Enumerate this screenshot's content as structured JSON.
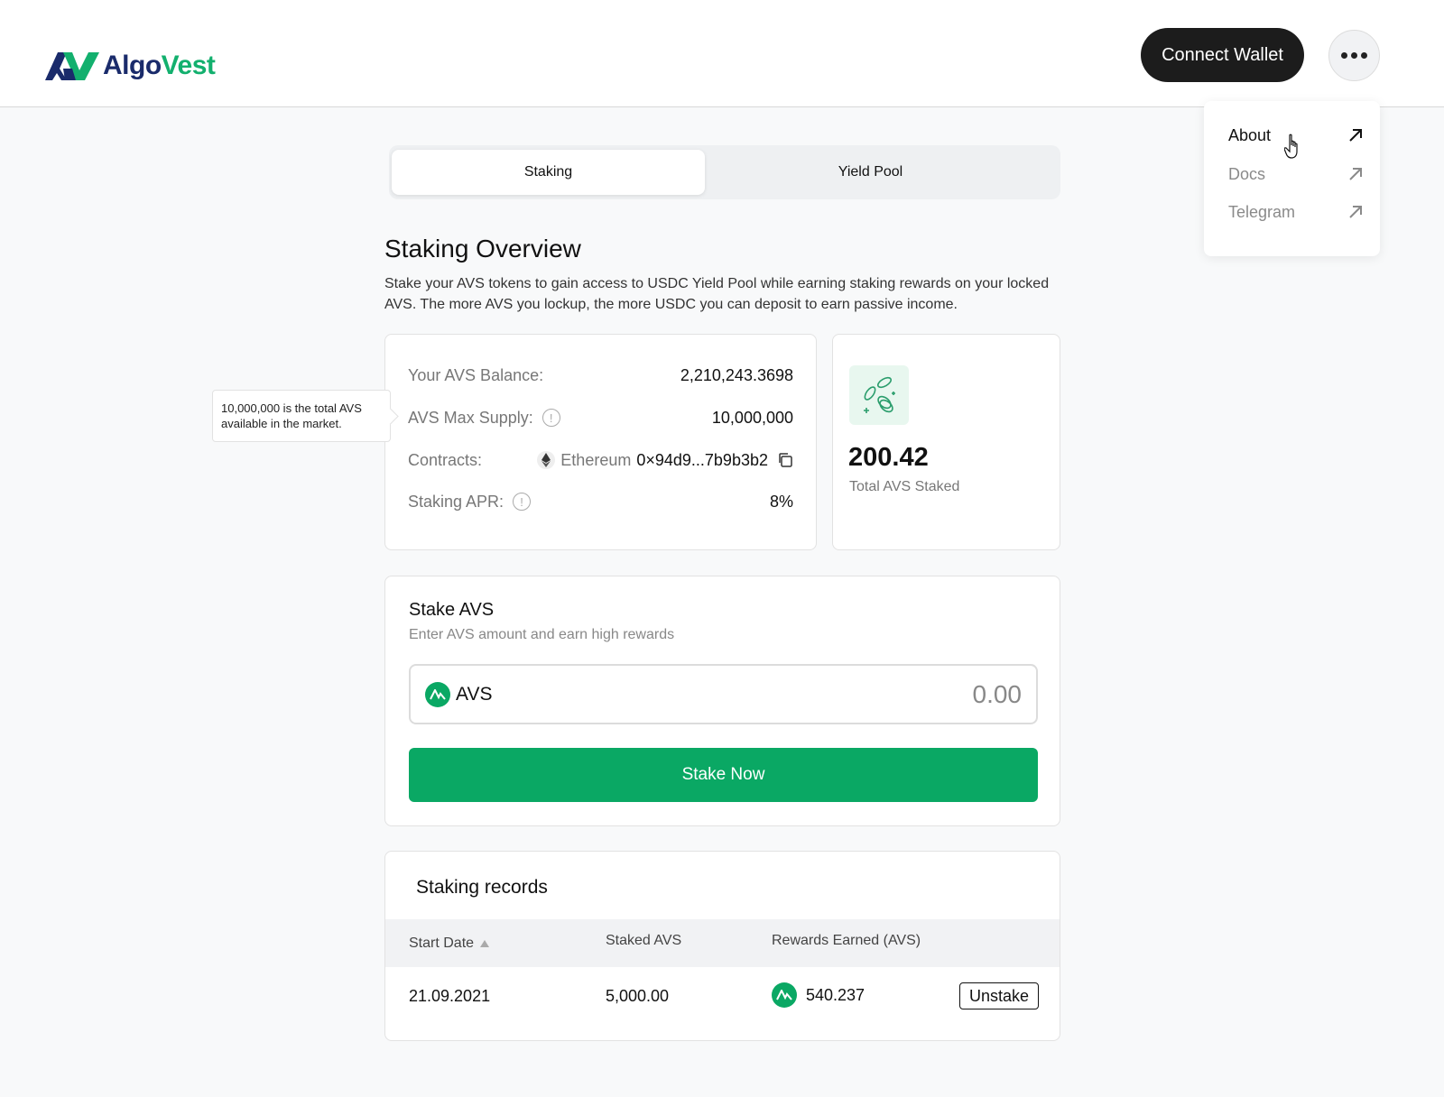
{
  "brand": {
    "name_part1": "Algo",
    "name_part2": "Vest",
    "primary_color": "#1a2b6b",
    "accent_color": "#13b06e"
  },
  "header": {
    "connect_label": "Connect Wallet",
    "more_icon": "more-dots-icon"
  },
  "menu": {
    "items": [
      {
        "label": "About",
        "icon": "arrow-up-right-icon"
      },
      {
        "label": "Docs",
        "icon": "arrow-up-right-icon"
      },
      {
        "label": "Telegram",
        "icon": "arrow-up-right-icon"
      }
    ]
  },
  "tabs": [
    {
      "label": "Staking"
    },
    {
      "label": "Yield Pool"
    }
  ],
  "overview": {
    "title": "Staking Overview",
    "description": "Stake your AVS tokens to gain access to USDC Yield Pool while earning staking rewards on your locked AVS. The more AVS you lockup, the more USDC you can deposit to earn passive income."
  },
  "info": {
    "balance_label": "Your AVS Balance:",
    "balance_value": "2,210,243.3698",
    "supply_label": "AVS Max Supply:",
    "supply_value": "10,000,000",
    "contracts_label": "Contracts:",
    "contracts_chain": "Ethereum",
    "contracts_address": "0×94d9...7b9b3b2",
    "apr_label": "Staking APR:",
    "apr_value": "8%"
  },
  "tooltip": {
    "text": "10,000,000 is the total AVS available in the market."
  },
  "staked": {
    "value": "200.42",
    "label": "Total AVS Staked"
  },
  "stake": {
    "title": "Stake AVS",
    "subtitle": "Enter AVS amount and earn high rewards",
    "token": "AVS",
    "placeholder": "0.00",
    "button_label": "Stake Now",
    "button_color": "#0aa864"
  },
  "records": {
    "title": "Staking records",
    "columns": [
      "Start Date",
      "Staked AVS",
      "Rewards Earned (AVS)"
    ],
    "rows": [
      {
        "start_date": "21.09.2021",
        "staked": "5,000.00",
        "rewards": "540.237",
        "action": "Unstake"
      }
    ]
  }
}
